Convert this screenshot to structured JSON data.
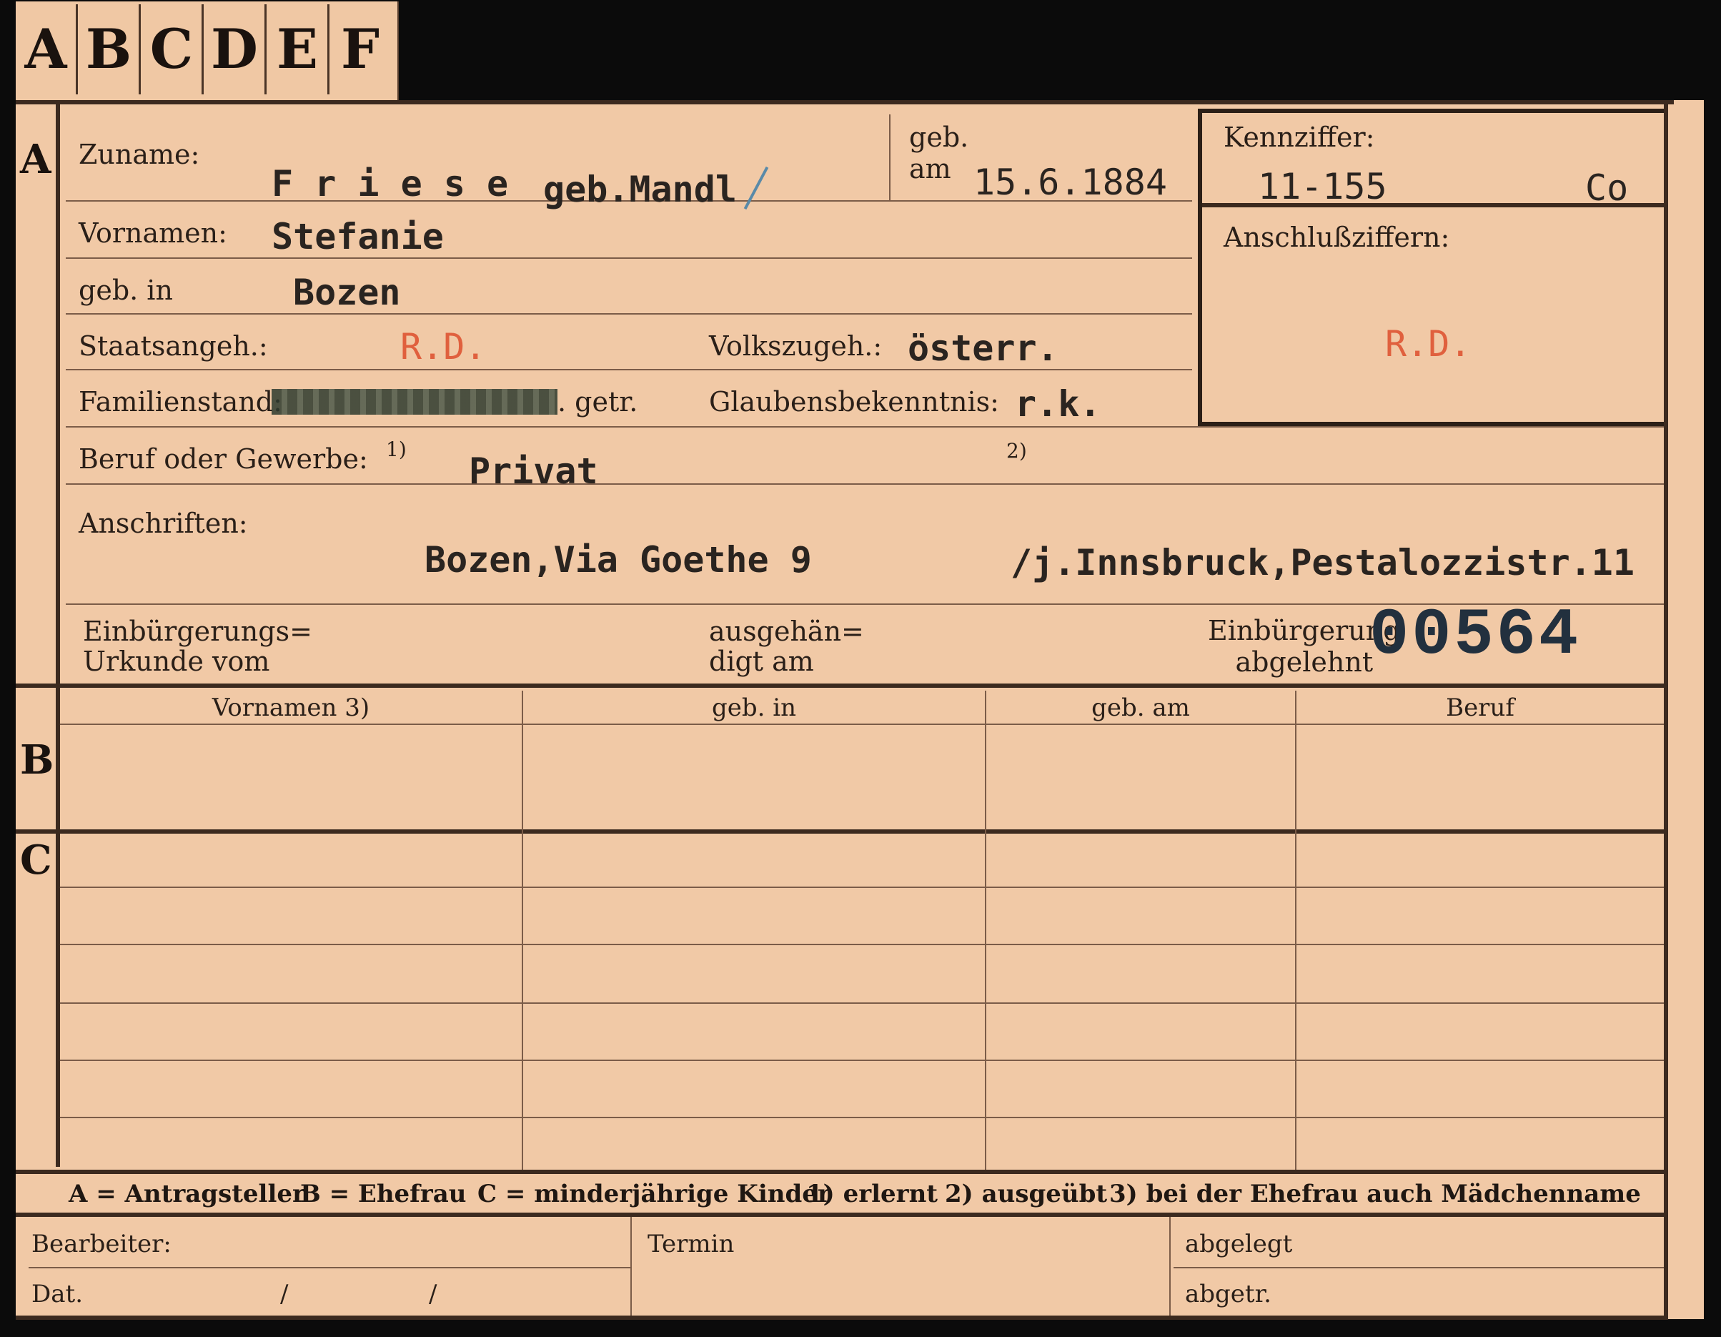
{
  "tabs": [
    "A",
    "B",
    "C",
    "D",
    "E",
    "F"
  ],
  "sections": {
    "a": "A",
    "b": "B",
    "c": "C"
  },
  "labels": {
    "zuname": "Zuname:",
    "geb_am": "geb.\nam",
    "kennziffer": "Kennziffer:",
    "anschlussziffern": "Anschlußziffern:",
    "vornamen": "Vornamen:",
    "geb_in": "geb. in",
    "staatsangeh": "Staatsangeh.:",
    "volkszugeh": "Volkszugeh.:",
    "familienstand": "Familienstand:",
    "getr": ". getr.",
    "glaubensbekenntnis": "Glaubensbekenntnis:",
    "beruf": "Beruf oder Gewerbe:",
    "fn1": "1)",
    "fn2": "2)",
    "anschriften": "Anschriften:",
    "einbuergerungs_urkunde": "Einbürgerungs=\nUrkunde vom",
    "ausgehaendigt": "ausgehän=\ndigt am",
    "einbuergerung_abgelehnt": "Einbürgerung\nabgelehnt"
  },
  "values": {
    "zuname": "F r i e s e",
    "zuname_suffix": "geb.Mandl",
    "geb_am": "15.6.1884",
    "kennziffer": "11-155",
    "kennziffer_suffix": "Co",
    "anschlussziffern": "R.D.",
    "vornamen": "Stefanie",
    "geb_in": "Bozen",
    "staatsangeh": "R.D.",
    "volkszugeh": "österr.",
    "glaubensbekenntnis": "r.k.",
    "beruf": "Privat",
    "anschrift_1": "Bozen,Via Goethe 9",
    "anschrift_2": "/j.Innsbruck,Pestalozzistr.11",
    "stamp_number": "00564"
  },
  "table": {
    "headers": [
      "Vornamen 3)",
      "geb. in",
      "geb. am",
      "Beruf"
    ]
  },
  "legend": {
    "a": "A = Antragsteller",
    "b": "B = Ehefrau",
    "c": "C = minderjährige Kinder",
    "n1": "1) erlernt",
    "n2": "2) ausgeübt",
    "n3": "3) bei der Ehefrau auch Mädchenname"
  },
  "footer": {
    "bearbeiter": "Bearbeiter:",
    "termin": "Termin",
    "abgelegt": "abgelegt",
    "dat": "Dat.",
    "slash1": "/",
    "slash2": "/",
    "abgetr": "abgetr."
  },
  "colors": {
    "card": "#f1c9a6",
    "ink": "#2a2420",
    "red_stamp": "#e0603e",
    "stamp_blue": "#22303e"
  }
}
